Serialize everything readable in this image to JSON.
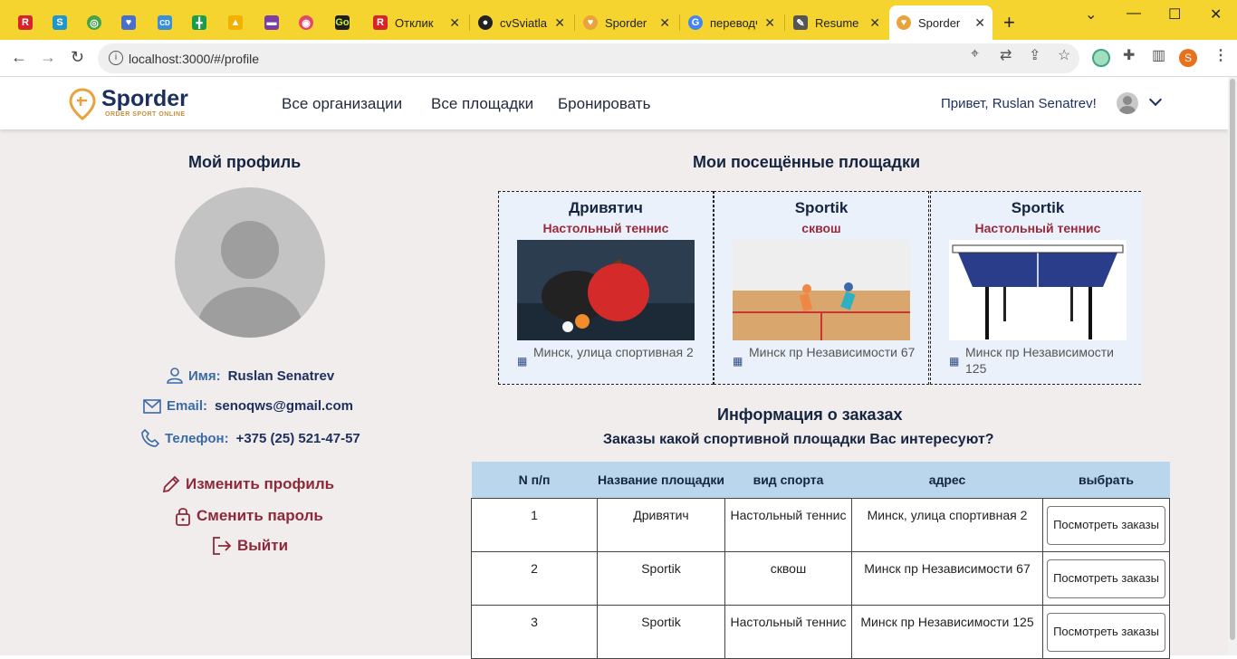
{
  "browser": {
    "tabs": [
      {
        "label": "Отклик"
      },
      {
        "label": "cvSviatlan"
      },
      {
        "label": "Sporder"
      },
      {
        "label": "переводч"
      },
      {
        "label": "Resume"
      },
      {
        "label": "Sporder"
      }
    ],
    "url": "localhost:3000/#/profile",
    "profile_initial": "S"
  },
  "app": {
    "logo": "Sporder",
    "logo_tagline": "ORDER SPORT ONLINE",
    "nav": [
      "Все организации",
      "Все площадки",
      "Бронировать"
    ],
    "greeting": "Привет, Ruslan Senatrev!"
  },
  "profile": {
    "title": "Мой профиль",
    "name_label": "Имя:",
    "name": "Ruslan Senatrev",
    "email_label": "Email:",
    "email": "senoqws@gmail.com",
    "phone_label": "Телефон:",
    "phone": "+375 (25) 521-47-57",
    "edit": "Изменить профиль",
    "change_password": "Сменить пароль",
    "logout": "Выйти"
  },
  "visited": {
    "title": "Мои посещённые площадки",
    "cards": [
      {
        "name": "Дривятич",
        "sport": "Настольный теннис",
        "address": "Минск, улица спортивная 2"
      },
      {
        "name": "Sportik",
        "sport": "сквош",
        "address": "Минск пр Независимости 67"
      },
      {
        "name": "Sportik",
        "sport": "Настольный теннис",
        "address": "Минск пр Независимости 125"
      }
    ]
  },
  "orders": {
    "title": "Информация о заказах",
    "subtitle": "Заказы какой спортивной площадки Вас интересуют?",
    "columns": [
      "N п/п",
      "Название площадки",
      "вид спорта",
      "адрес",
      "выбрать"
    ],
    "rows": [
      {
        "n": "1",
        "name": "Дривятич",
        "sport": "Настольный теннис",
        "address": "Минск, улица спортивная 2",
        "button": "Посмотреть заказы"
      },
      {
        "n": "2",
        "name": "Sportik",
        "sport": "сквош",
        "address": "Минск пр Независимости 67",
        "button": "Посмотреть заказы"
      },
      {
        "n": "3",
        "name": "Sportik",
        "sport": "Настольный теннис",
        "address": "Минск пр Независимости 125",
        "button": "Посмотреть заказы"
      }
    ]
  },
  "colors": {
    "tabbar": "#f5d430",
    "accent": "#9a2a3a",
    "navy": "#152541",
    "table_header": "#b9d6ec"
  }
}
